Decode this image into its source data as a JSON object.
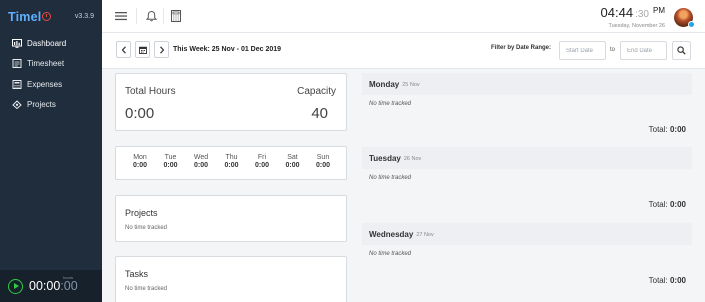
{
  "app": {
    "name": "Timel",
    "version": "v3.3.9"
  },
  "sidebar": {
    "items": [
      {
        "label": "Dashboard",
        "icon": "dashboard-icon"
      },
      {
        "label": "Timesheet",
        "icon": "timesheet-icon"
      },
      {
        "label": "Expenses",
        "icon": "expenses-icon"
      },
      {
        "label": "Projects",
        "icon": "projects-icon"
      }
    ],
    "timer": {
      "main": "00:00",
      "seconds": "00",
      "label": "hours"
    }
  },
  "header": {
    "icons": [
      "menu-icon",
      "bell-icon",
      "calculator-icon"
    ],
    "clock": {
      "time": "04:44",
      "seconds": ":30",
      "ampm": "PM",
      "date": "Tuesday, November 26"
    }
  },
  "toolbar": {
    "week_label": "This Week: 25 Nov - 01 Dec 2019",
    "filter_label": "Filter by Date Range:",
    "start_placeholder": "Start Date",
    "to_label": "to",
    "end_placeholder": "End Date"
  },
  "summary": {
    "total_hours_label": "Total Hours",
    "total_hours_value": "0:00",
    "capacity_label": "Capacity",
    "capacity_value": "40"
  },
  "week_days": [
    {
      "name": "Mon",
      "value": "0:00"
    },
    {
      "name": "Tue",
      "value": "0:00"
    },
    {
      "name": "Wed",
      "value": "0:00"
    },
    {
      "name": "Thu",
      "value": "0:00"
    },
    {
      "name": "Fri",
      "value": "0:00"
    },
    {
      "name": "Sat",
      "value": "0:00"
    },
    {
      "name": "Sun",
      "value": "0:00"
    }
  ],
  "projects": {
    "title": "Projects",
    "empty": "No time tracked"
  },
  "tasks": {
    "title": "Tasks",
    "empty": "No time tracked"
  },
  "day_log": [
    {
      "name": "Monday",
      "date": "25 Nov",
      "empty": "No time tracked",
      "total_label": "Total:",
      "total": "0:00"
    },
    {
      "name": "Tuesday",
      "date": "26 Nov",
      "empty": "No time tracked",
      "total_label": "Total:",
      "total": "0:00"
    },
    {
      "name": "Wednesday",
      "date": "27 Nov",
      "empty": "No time tracked",
      "total_label": "Total:",
      "total": "0:00"
    }
  ],
  "colors": {
    "sidebar_bg": "#1f2d3d",
    "brand": "#5fb0ff",
    "timer_green": "#2ecc40",
    "status_blue": "#23a3ea"
  }
}
